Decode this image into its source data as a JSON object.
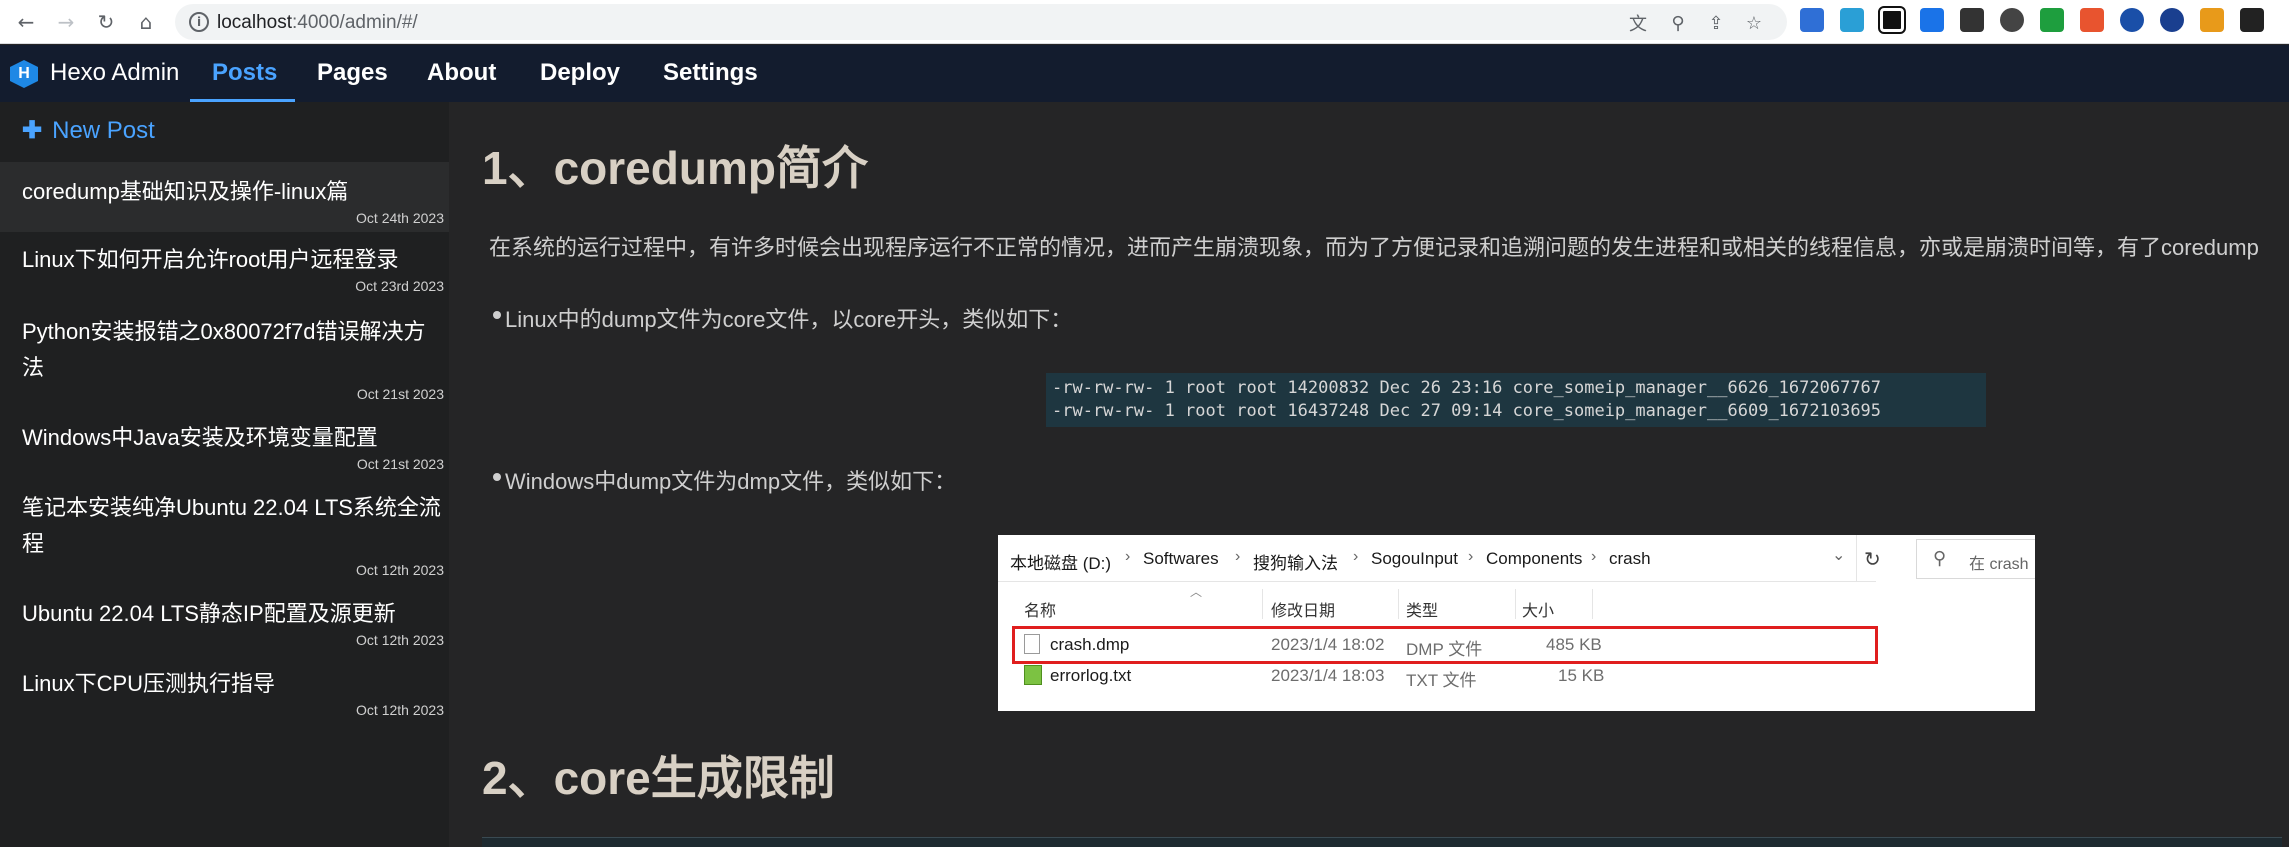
{
  "browser": {
    "url_host": "localhost",
    "url_path": ":4000/admin/#/"
  },
  "header": {
    "brand": "Hexo Admin",
    "nav": [
      {
        "label": "Posts"
      },
      {
        "label": "Pages"
      },
      {
        "label": "About"
      },
      {
        "label": "Deploy"
      },
      {
        "label": "Settings"
      }
    ]
  },
  "sidebar": {
    "new_post_label": "New Post",
    "posts": [
      {
        "title": "coredump基础知识及操作-linux篇",
        "date": "Oct 24th 2023"
      },
      {
        "title": "Linux下如何开启允许root用户远程登录",
        "date": "Oct 23rd 2023"
      },
      {
        "title": "Python安装报错之0x80072f7d错误解决方法",
        "date": "Oct 21st 2023"
      },
      {
        "title": "Windows中Java安装及环境变量配置",
        "date": "Oct 21st 2023"
      },
      {
        "title": "笔记本安装纯净Ubuntu 22.04 LTS系统全流程",
        "date": "Oct 12th 2023"
      },
      {
        "title": "Ubuntu 22.04 LTS静态IP配置及源更新",
        "date": "Oct 12th 2023"
      },
      {
        "title": "Linux下CPU压测执行指导",
        "date": "Oct 12th 2023"
      }
    ]
  },
  "content": {
    "heading1": "1、coredump简介",
    "paragraph": "在系统的运行过程中，有许多时候会出现程序运行不正常的情况，进而产生崩溃现象，而为了方便记录和追溯问题的发生进程和或相关的线程信息，亦或是崩溃时间等，有了coredump",
    "bullet1": "Linux中的dump文件为core文件，以core开头，类似如下：",
    "code_lines": [
      "-rw-rw-rw- 1 root root 14200832 Dec 26 23:16 core_someip_manager__6626_1672067767",
      "-rw-rw-rw- 1 root root 16437248 Dec 27 09:14 core_someip_manager__6609_1672103695"
    ],
    "bullet2": "Windows中dump文件为dmp文件，类似如下：",
    "heading2": "2、core生成限制"
  },
  "explorer": {
    "breadcrumb": [
      "本地磁盘 (D:)",
      "Softwares",
      "搜狗输入法",
      "SogouInput",
      "Components",
      "crash"
    ],
    "search_placeholder": "在 crash",
    "columns": [
      "名称",
      "修改日期",
      "类型",
      "大小"
    ],
    "files": [
      {
        "name": "crash.dmp",
        "modified": "2023/1/4 18:02",
        "type": "DMP 文件",
        "size": "485 KB"
      },
      {
        "name": "errorlog.txt",
        "modified": "2023/1/4 18:03",
        "type": "TXT 文件",
        "size": "15 KB"
      }
    ]
  }
}
